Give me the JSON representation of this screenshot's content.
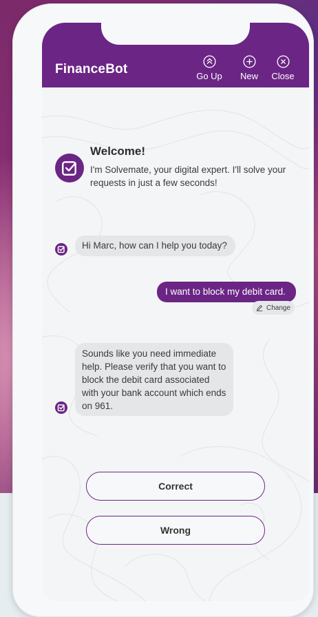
{
  "app": {
    "title": "FinanceBot",
    "accent_color": "#6b2585"
  },
  "header": {
    "buttons": [
      {
        "label": "Go Up",
        "icon": "chevron-double-up-icon"
      },
      {
        "label": "New",
        "icon": "plus-circle-icon"
      },
      {
        "label": "Close",
        "icon": "close-circle-icon"
      }
    ]
  },
  "welcome": {
    "title": "Welcome!",
    "text": "I'm Solvemate, your digital expert. I'll solve your requests in just a few seconds!",
    "icon": "checkbox-icon"
  },
  "messages": [
    {
      "from": "bot",
      "text": "Hi Marc, how can I help you today?"
    },
    {
      "from": "user",
      "text": "I want to block my debit card.",
      "action": "Change",
      "action_icon": "pencil-icon"
    },
    {
      "from": "bot",
      "text": "Sounds like you need immediate help. Please verify that you want to block the debit card associated with your bank account which ends on 961."
    }
  ],
  "options": [
    {
      "label": "Correct"
    },
    {
      "label": "Wrong"
    }
  ]
}
